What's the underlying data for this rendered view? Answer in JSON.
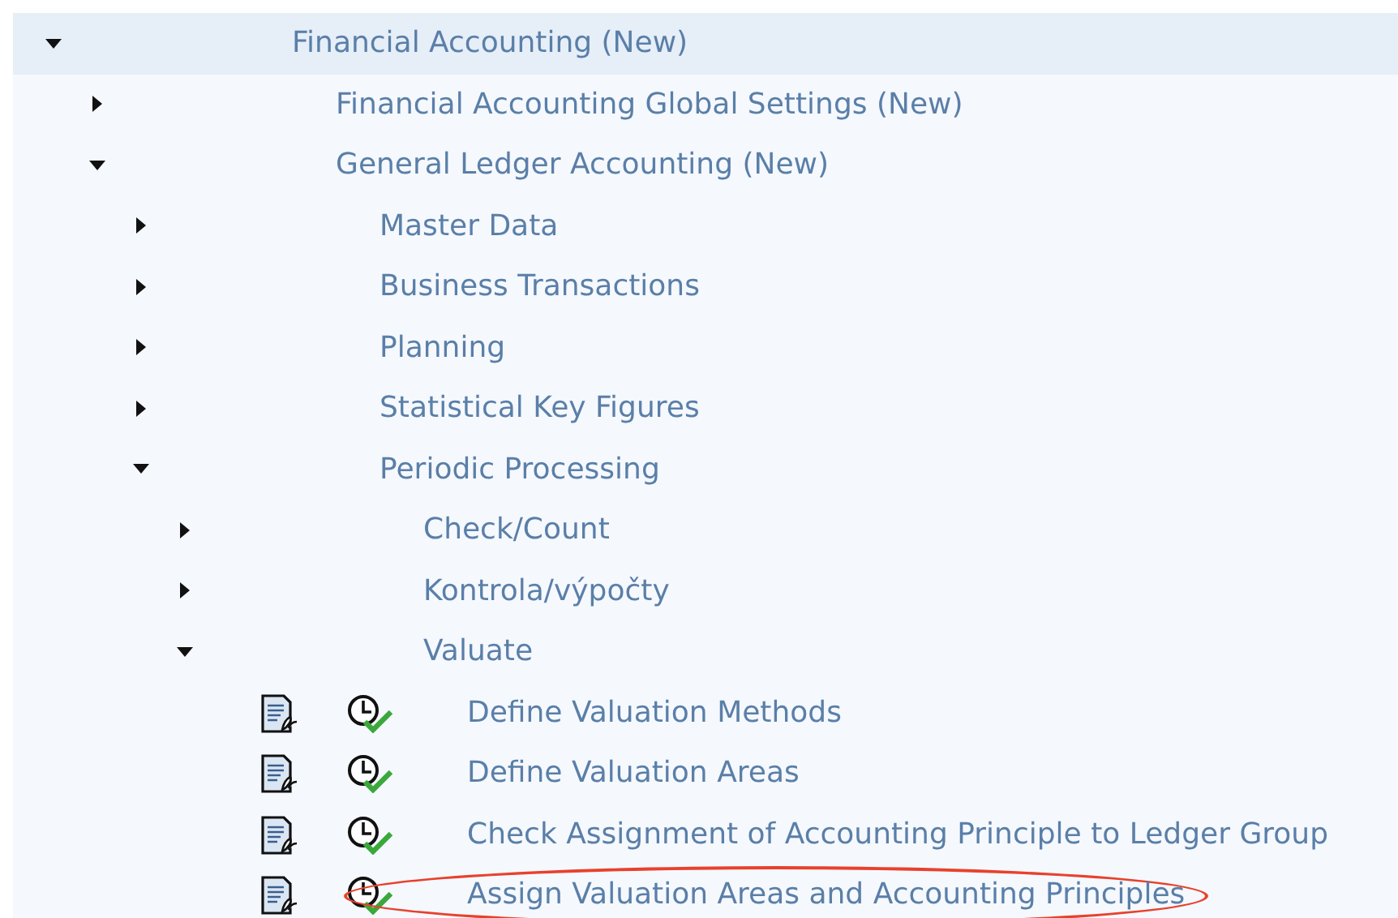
{
  "tree": [
    {
      "label": "Financial Accounting (New)",
      "expanded": true,
      "selected": true,
      "children": [
        {
          "label": "Financial Accounting Global Settings (New)",
          "expanded": false,
          "selected": false
        },
        {
          "label": "General Ledger Accounting (New)",
          "expanded": true,
          "selected": false,
          "children": [
            {
              "label": "Master Data",
              "expanded": false,
              "selected": false
            },
            {
              "label": "Business Transactions",
              "expanded": false,
              "selected": false
            },
            {
              "label": "Planning",
              "expanded": false,
              "selected": false
            },
            {
              "label": "Statistical Key Figures",
              "expanded": false,
              "selected": false
            },
            {
              "label": "Periodic Processing",
              "expanded": true,
              "selected": false,
              "children": [
                {
                  "label": "Check/Count",
                  "expanded": false,
                  "selected": false
                },
                {
                  "label": "Kontrola/výpočty",
                  "expanded": false,
                  "selected": false
                },
                {
                  "label": "Valuate",
                  "expanded": true,
                  "selected": false,
                  "children": [
                    {
                      "kind": "activity",
                      "label": "Define Valuation Methods",
                      "selected": false,
                      "circled": false
                    },
                    {
                      "kind": "activity",
                      "label": "Define Valuation Areas",
                      "selected": false,
                      "circled": false
                    },
                    {
                      "kind": "activity",
                      "label": "Check Assignment of Accounting Principle to Ledger Group",
                      "selected": false,
                      "circled": false
                    },
                    {
                      "kind": "activity",
                      "label": "Assign Valuation Areas and Accounting Principles",
                      "selected": false,
                      "circled": true
                    }
                  ]
                }
              ]
            }
          ]
        }
      ]
    }
  ]
}
